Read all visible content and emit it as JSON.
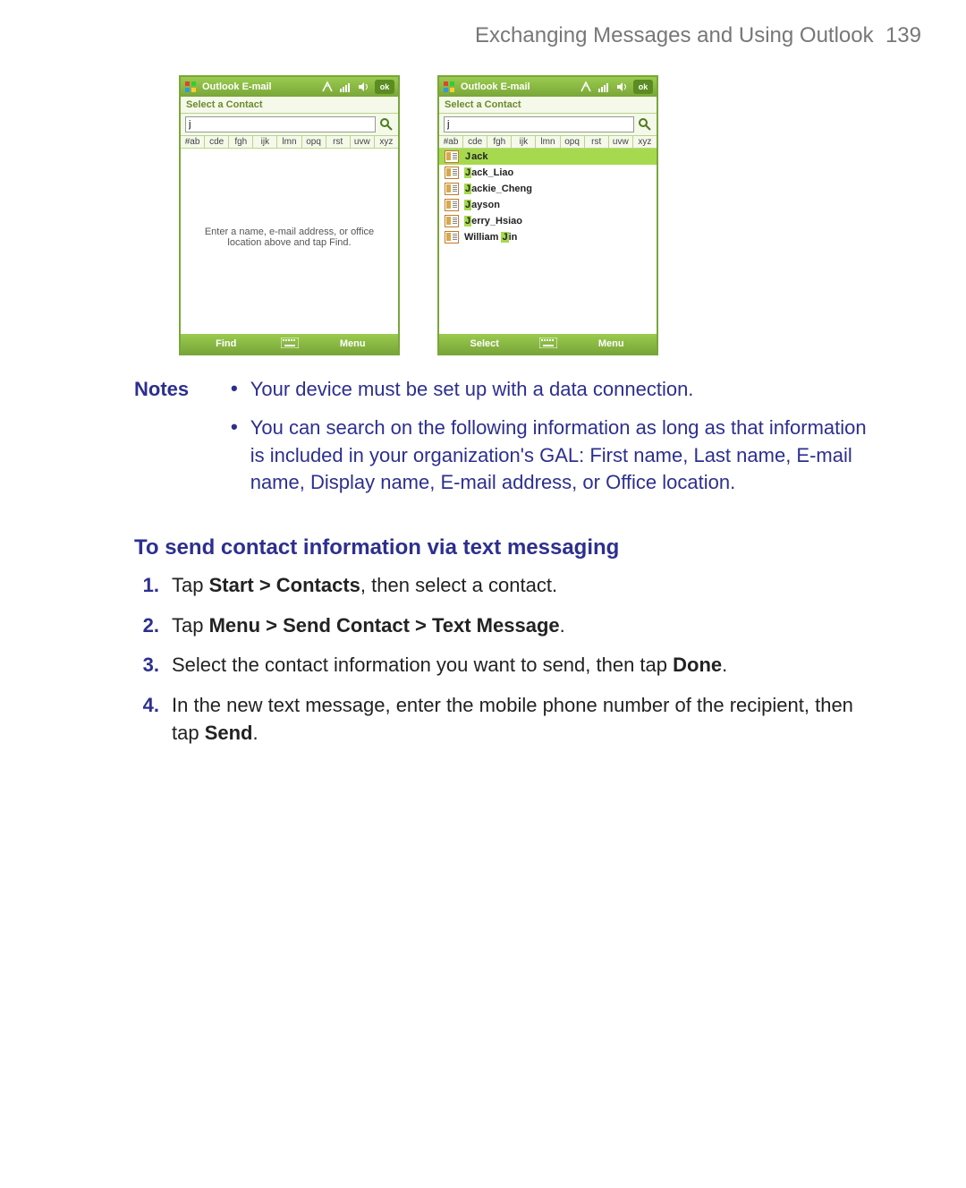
{
  "header": {
    "title": "Exchanging Messages and Using Outlook",
    "page_number": "139"
  },
  "phone_left": {
    "titlebar_label": "Outlook E-mail",
    "ok_label": "ok",
    "subtitle": "Select a Contact",
    "search_value": "j",
    "alpha_tabs": [
      "#ab",
      "cde",
      "fgh",
      "ijk",
      "lmn",
      "opq",
      "rst",
      "uvw",
      "xyz"
    ],
    "empty_hint": "Enter a name, e-mail address, or office location above and tap Find.",
    "softkey_left": "Find",
    "softkey_right": "Menu"
  },
  "phone_right": {
    "titlebar_label": "Outlook E-mail",
    "ok_label": "ok",
    "subtitle": "Select a Contact",
    "search_value": "j",
    "alpha_tabs": [
      "#ab",
      "cde",
      "fgh",
      "ijk",
      "lmn",
      "opq",
      "rst",
      "uvw",
      "xyz"
    ],
    "results": [
      {
        "prefix": "J",
        "rest": "ack",
        "selected": true
      },
      {
        "prefix": "J",
        "rest": "ack_Liao",
        "selected": false
      },
      {
        "prefix": "J",
        "rest": "ackie_Cheng",
        "selected": false
      },
      {
        "prefix": "J",
        "rest": "ayson",
        "selected": false
      },
      {
        "prefix": "J",
        "rest": "erry_Hsiao",
        "selected": false
      },
      {
        "before": "William ",
        "prefix": "J",
        "rest": "in",
        "selected": false
      }
    ],
    "softkey_left": "Select",
    "softkey_right": "Menu"
  },
  "notes": {
    "label": "Notes",
    "items": [
      "Your device must be set up with a data connection.",
      "You can search on the following information as long as that information is included in your organization's GAL: First name, Last name, E-mail name, Display name, E-mail address, or Office location."
    ]
  },
  "heading": "To send contact information via text messaging",
  "steps": [
    {
      "num": "1.",
      "pre": "Tap ",
      "bold1": "Start > Contacts",
      "post1": ", then select a contact."
    },
    {
      "num": "2.",
      "pre": "Tap ",
      "bold1": "Menu > Send Contact > Text Message",
      "post1": "."
    },
    {
      "num": "3.",
      "pre": "Select the contact information you want to send, then tap ",
      "bold1": "Done",
      "post1": "."
    },
    {
      "num": "4.",
      "pre": "In the new text message, enter the mobile phone number of the recipient, then tap ",
      "bold1": "Send",
      "post1": "."
    }
  ]
}
